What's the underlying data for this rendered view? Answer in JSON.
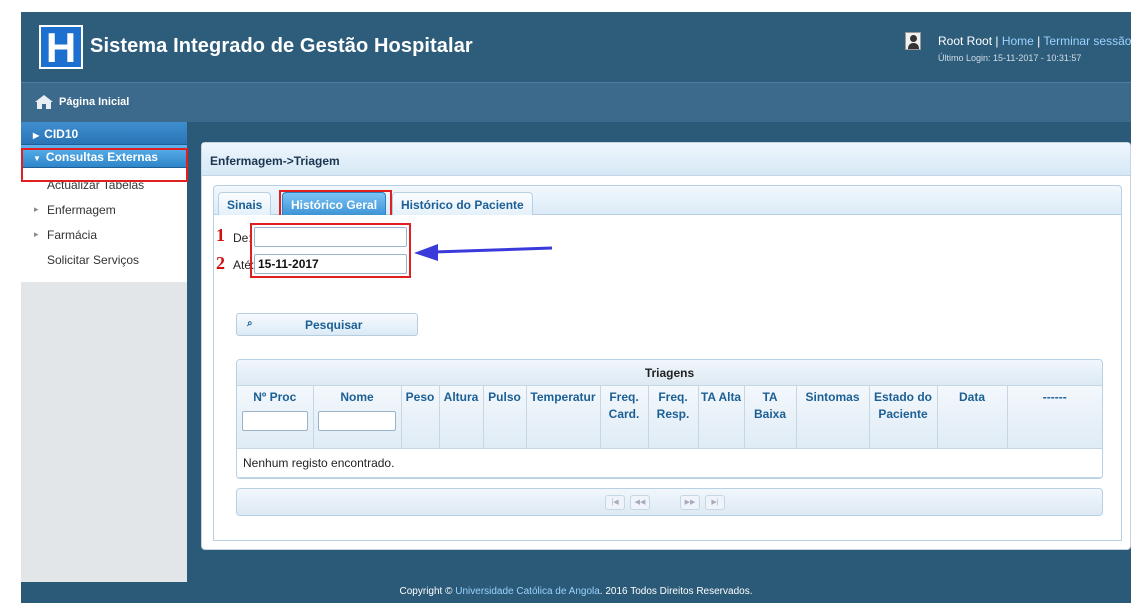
{
  "header": {
    "logo_letter": "H",
    "title": "Sistema Integrado de Gestão Hospitalar",
    "user_name": "Root Root",
    "home_link": "Home",
    "logout_link": "Terminar sessão",
    "separator": " | ",
    "last_login": "Último Login: 15-11-2017 - 10:31:57"
  },
  "navbar": {
    "home_label": "Página Inicial"
  },
  "sidebar": {
    "group1": "CID10",
    "group2": "Consultas Externas",
    "items": [
      "Actualizar Tabelas",
      "Enfermagem",
      "Farmácia",
      "Solicitar Serviços"
    ]
  },
  "content": {
    "breadcrumb": "Enfermagem->Triagem",
    "tabs": [
      "Sinais",
      "Histórico Geral",
      "Histórico do Paciente"
    ],
    "annotation_1": "1",
    "annotation_2": "2",
    "from_label": "De:",
    "from_value": "",
    "to_label": "Até:",
    "to_value": "15-11-2017",
    "search_button": "Pesquisar",
    "grid_title": "Triagens",
    "columns": [
      "Nº Proc",
      "Nome",
      "Peso",
      "Altura",
      "Pulso",
      "Temperatur",
      "Freq. Card.",
      "Freq. Resp.",
      "TA Alta",
      "TA Baixa",
      "Sintomas",
      "Estado do Paciente",
      "Data",
      "------"
    ],
    "empty_message": "Nenhum registo encontrado."
  },
  "footer": {
    "prefix": "Copyright © ",
    "org": "Universidade Católica de Angola",
    "suffix": ". 2016 Todos Direitos Reservados."
  },
  "colors": {
    "highlight": "#e02020",
    "arrow": "#3a3adb",
    "accent": "#2a74b5"
  }
}
